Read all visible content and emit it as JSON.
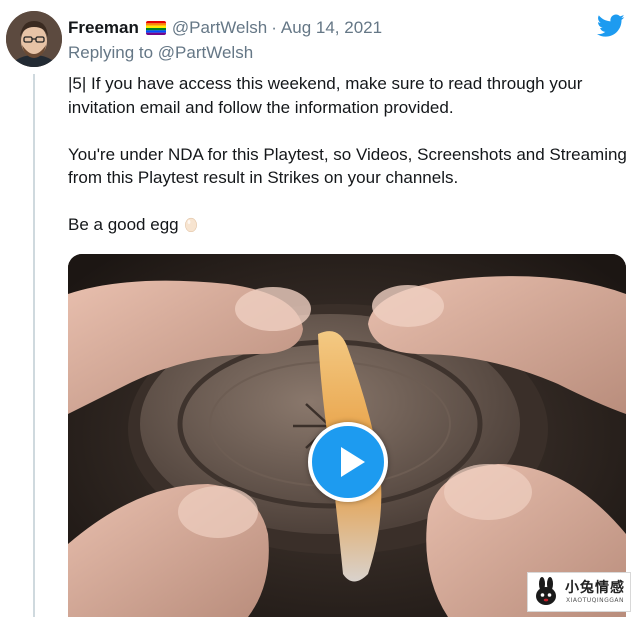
{
  "tweet": {
    "display_name": "Freeman",
    "flag_icon": "rainbow-flag-icon",
    "handle": "@PartWelsh",
    "separator": "·",
    "date": "Aug 14, 2021",
    "reply_prefix": "Replying to",
    "reply_handle": "@PartWelsh",
    "body_paragraphs": [
      "|5| If you have access this weekend, make sure to read through your invitation email and follow the information provided.",
      "You're under NDA for this Playtest, so Videos, Screenshots and Streaming from this Playtest result in Strikes on your channels.",
      "Be a good egg"
    ],
    "emoji_icon": "egg-icon",
    "media": {
      "type": "video",
      "play_icon": "play-icon"
    }
  },
  "brand": {
    "logo_icon": "twitter-bird-icon",
    "accent": "#1d9bf0"
  },
  "watermark": {
    "logo_icon": "rabbit-logo-icon",
    "text_cn": "小兔情感",
    "text_en": "XIAOTUQINGGAN"
  },
  "colors": {
    "text_primary": "#14171a",
    "text_secondary": "#657786",
    "play_button": "#1d9bf0",
    "thread_line": "#cfd9de"
  }
}
